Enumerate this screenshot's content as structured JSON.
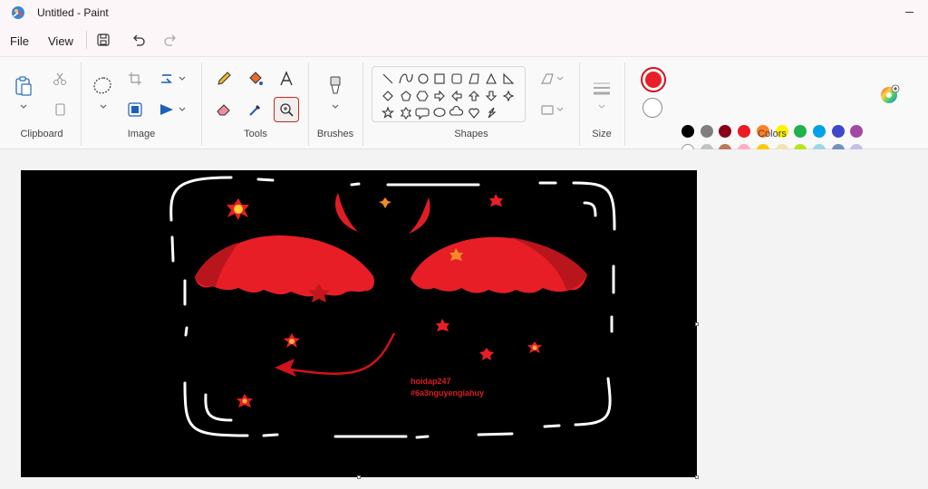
{
  "window": {
    "title": "Untitled - Paint"
  },
  "menu": {
    "file": "File",
    "view": "View"
  },
  "ribbon": {
    "groups": {
      "clipboard": "Clipboard",
      "image": "Image",
      "tools": "Tools",
      "brushes": "Brushes",
      "shapes": "Shapes",
      "size": "Size",
      "colors": "Colors"
    }
  },
  "colors": {
    "color1": "#e81e2a",
    "color2": "#ffffff",
    "palette_row1": [
      "#000000",
      "#7f7f7f",
      "#880015",
      "#ed1c24",
      "#ff7f27",
      "#fff200",
      "#22b14c",
      "#00a2e8",
      "#3f48cc",
      "#a349a4"
    ],
    "palette_row2": [
      "#ffffff",
      "#c3c3c3",
      "#b97a57",
      "#ffaec9",
      "#ffc90e",
      "#efe4b0",
      "#b5e61d",
      "#99d9ea",
      "#7092be",
      "#c8bfe7"
    ],
    "palette_row3": [
      "#d0121b",
      "#c0111a"
    ]
  },
  "canvas_text": {
    "line1": "hoidap247",
    "line2": "#6a3nguyengiahuy"
  }
}
